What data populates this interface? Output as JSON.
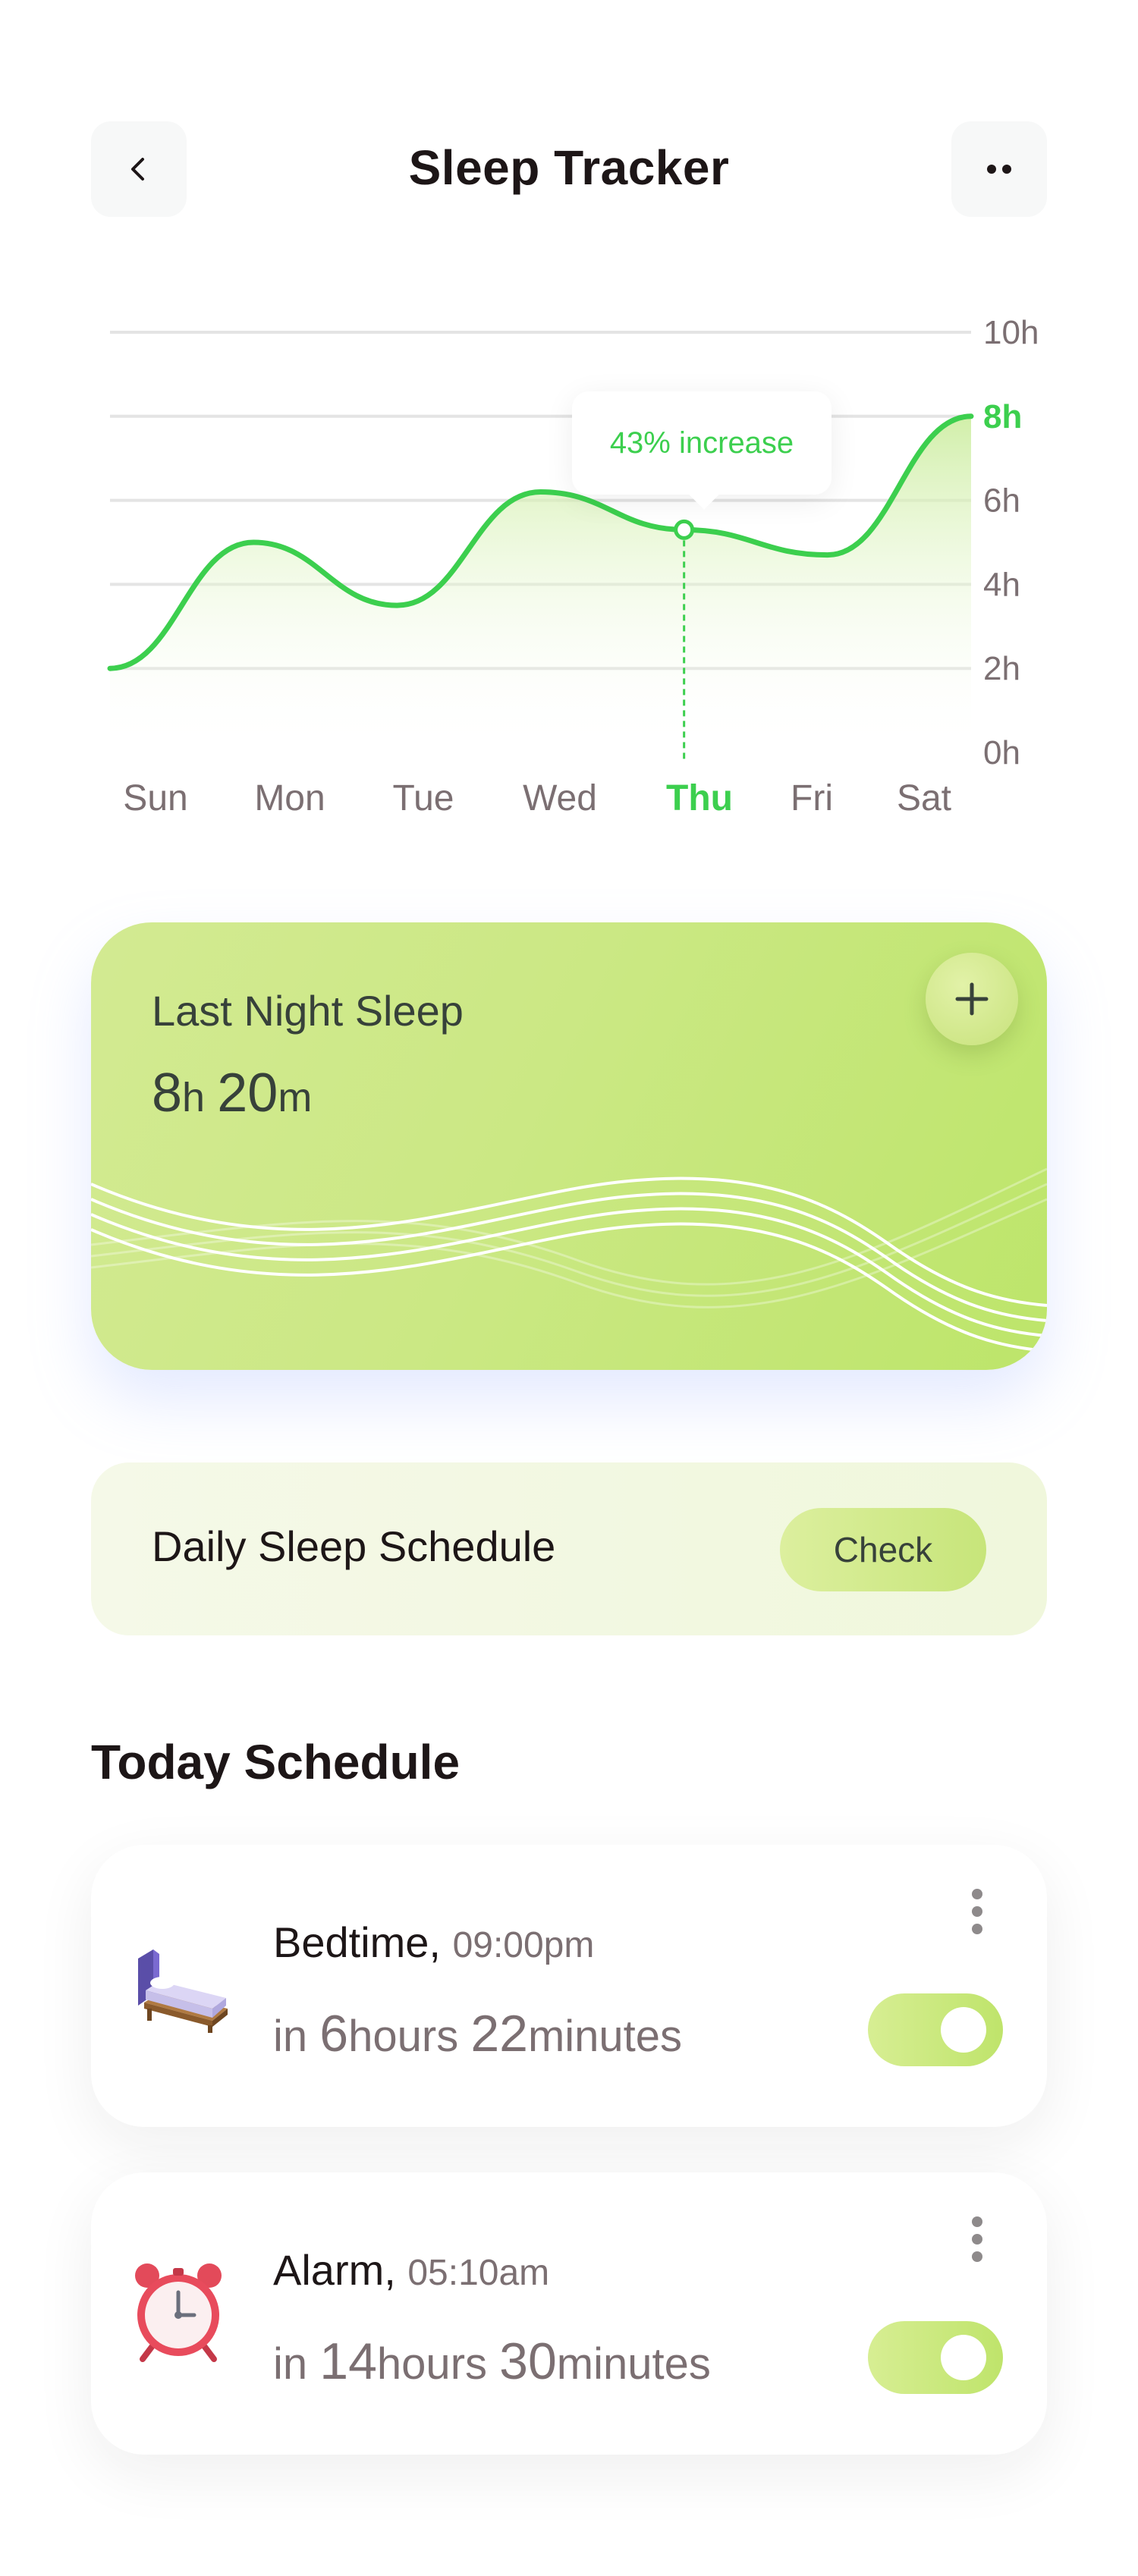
{
  "header": {
    "title": "Sleep Tracker",
    "back_icon": "chevron-left-icon",
    "more_icon": "more-horizontal-icon"
  },
  "chart_data": {
    "type": "area",
    "categories": [
      "Sun",
      "Mon",
      "Tue",
      "Wed",
      "Thu",
      "Fri",
      "Sat"
    ],
    "values": [
      2.0,
      5.0,
      3.5,
      6.2,
      5.3,
      4.7,
      8.0
    ],
    "y_ticks": [
      "0h",
      "2h",
      "4h",
      "6h",
      "8h",
      "10h"
    ],
    "ylim": [
      0,
      10
    ],
    "highlight_category": "Thu",
    "highlight_tick": "8h",
    "annotation": "43% increase",
    "grid": true,
    "colors": {
      "line": "#3ccf4e",
      "active": "#3ccf4e",
      "label": "#7b6f72",
      "grid": "#e4e4e4"
    }
  },
  "last_night": {
    "title": "Last Night Sleep",
    "hours": "8",
    "hours_unit": "h",
    "minutes": "20",
    "minutes_unit": "m",
    "add_icon": "plus-icon"
  },
  "daily_schedule": {
    "label": "Daily Sleep Schedule",
    "button": "Check"
  },
  "today": {
    "title": "Today Schedule",
    "items": [
      {
        "name": "Bedtime,",
        "time": "09:00pm",
        "prefix": "in",
        "n1": "6",
        "u1": "hours",
        "n2": "22",
        "u2": "minutes",
        "icon": "bed-icon",
        "enabled": true
      },
      {
        "name": "Alarm,",
        "time": "05:10am",
        "prefix": "in",
        "n1": "14",
        "u1": "hours",
        "n2": "30",
        "u2": "minutes",
        "icon": "alarm-clock-icon",
        "enabled": true
      }
    ]
  },
  "colors": {
    "accent": "#3ccf4e",
    "card_green": "#c8e67c",
    "text_dark": "#1d1617",
    "text_gray": "#7b6f72"
  }
}
